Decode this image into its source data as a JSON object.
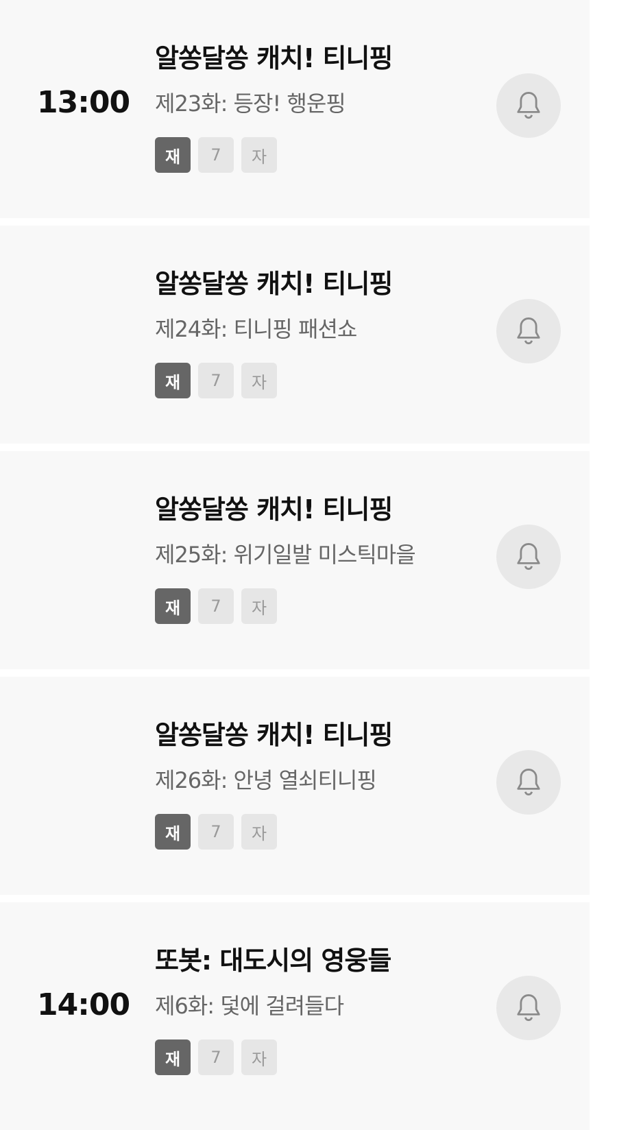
{
  "programs": [
    {
      "time": "13:00",
      "title": "알쏭달쏭 캐치! 티니핑",
      "episode": "제23화: 등장! 행운핑",
      "badges": [
        "재",
        "7",
        "자"
      ]
    },
    {
      "time": "",
      "title": "알쏭달쏭 캐치! 티니핑",
      "episode": "제24화: 티니핑 패션쇼",
      "badges": [
        "재",
        "7",
        "자"
      ]
    },
    {
      "time": "",
      "title": "알쏭달쏭 캐치! 티니핑",
      "episode": "제25화: 위기일발 미스틱마을",
      "badges": [
        "재",
        "7",
        "자"
      ]
    },
    {
      "time": "",
      "title": "알쏭달쏭 캐치! 티니핑",
      "episode": "제26화: 안녕 열쇠티니핑",
      "badges": [
        "재",
        "7",
        "자"
      ]
    },
    {
      "time": "14:00",
      "title": "또봇: 대도시의 영웅들",
      "episode": "제6화: 덫에 걸려들다",
      "badges": [
        "재",
        "7",
        "자"
      ]
    }
  ],
  "icons": {
    "bell": "bell-icon"
  },
  "colors": {
    "card_bg": "#f8f8f8",
    "rerun_badge_bg": "#666666",
    "badge_bg": "#e6e6e6",
    "bell_bg": "#e8e8e8"
  }
}
